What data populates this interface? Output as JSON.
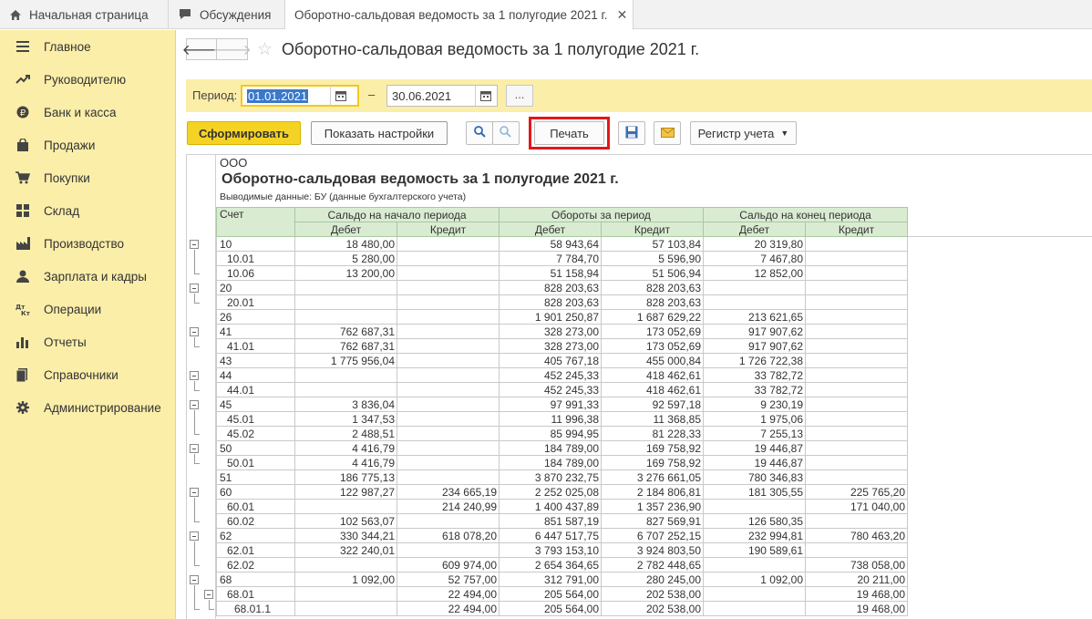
{
  "tabs": [
    {
      "label": "Начальная страница"
    },
    {
      "label": "Обсуждения"
    },
    {
      "label": "Оборотно-сальдовая ведомость за 1 полугодие 2021 г."
    }
  ],
  "sidebar": {
    "items": [
      {
        "label": "Главное",
        "icon": "menu-icon"
      },
      {
        "label": "Руководителю",
        "icon": "trend-icon"
      },
      {
        "label": "Банк и касса",
        "icon": "ruble-icon"
      },
      {
        "label": "Продажи",
        "icon": "bag-icon"
      },
      {
        "label": "Покупки",
        "icon": "cart-icon"
      },
      {
        "label": "Склад",
        "icon": "grid-icon"
      },
      {
        "label": "Производство",
        "icon": "factory-icon"
      },
      {
        "label": "Зарплата и кадры",
        "icon": "person-icon"
      },
      {
        "label": "Операции",
        "icon": "dt-kt-icon"
      },
      {
        "label": "Отчеты",
        "icon": "bar-chart-icon"
      },
      {
        "label": "Справочники",
        "icon": "books-icon"
      },
      {
        "label": "Администрирование",
        "icon": "gear-icon"
      }
    ]
  },
  "header": {
    "title": "Оборотно-сальдовая ведомость за 1 полугодие 2021 г."
  },
  "period": {
    "label": "Период:",
    "from": "01.01.2021",
    "dash": "–",
    "to": "30.06.2021",
    "more": "..."
  },
  "toolbar": {
    "generate": "Сформировать",
    "show_settings": "Показать настройки",
    "print": "Печать",
    "register": "Регистр учета"
  },
  "report": {
    "org": "ООО",
    "title": "Оборотно-сальдовая ведомость за 1 полугодие 2021 г.",
    "subtitle": "Выводимые данные:   БУ (данные бухгалтерского учета)",
    "headers": {
      "account": "Счет",
      "opening": "Сальдо на начало периода",
      "turnover": "Обороты за период",
      "closing": "Сальдо на конец периода",
      "debit": "Дебет",
      "credit": "Кредит"
    },
    "rows": [
      [
        "10",
        "18 480,00",
        "",
        "58 943,64",
        "57 103,84",
        "20 319,80",
        ""
      ],
      [
        "10.01",
        "5 280,00",
        "",
        "7 784,70",
        "5 596,90",
        "7 467,80",
        ""
      ],
      [
        "10.06",
        "13 200,00",
        "",
        "51 158,94",
        "51 506,94",
        "12 852,00",
        ""
      ],
      [
        "20",
        "",
        "",
        "828 203,63",
        "828 203,63",
        "",
        ""
      ],
      [
        "20.01",
        "",
        "",
        "828 203,63",
        "828 203,63",
        "",
        ""
      ],
      [
        "26",
        "",
        "",
        "1 901 250,87",
        "1 687 629,22",
        "213 621,65",
        ""
      ],
      [
        "41",
        "762 687,31",
        "",
        "328 273,00",
        "173 052,69",
        "917 907,62",
        ""
      ],
      [
        "41.01",
        "762 687,31",
        "",
        "328 273,00",
        "173 052,69",
        "917 907,62",
        ""
      ],
      [
        "43",
        "1 775 956,04",
        "",
        "405 767,18",
        "455 000,84",
        "1 726 722,38",
        ""
      ],
      [
        "44",
        "",
        "",
        "452 245,33",
        "418 462,61",
        "33 782,72",
        ""
      ],
      [
        "44.01",
        "",
        "",
        "452 245,33",
        "418 462,61",
        "33 782,72",
        ""
      ],
      [
        "45",
        "3 836,04",
        "",
        "97 991,33",
        "92 597,18",
        "9 230,19",
        ""
      ],
      [
        "45.01",
        "1 347,53",
        "",
        "11 996,38",
        "11 368,85",
        "1 975,06",
        ""
      ],
      [
        "45.02",
        "2 488,51",
        "",
        "85 994,95",
        "81 228,33",
        "7 255,13",
        ""
      ],
      [
        "50",
        "4 416,79",
        "",
        "184 789,00",
        "169 758,92",
        "19 446,87",
        ""
      ],
      [
        "50.01",
        "4 416,79",
        "",
        "184 789,00",
        "169 758,92",
        "19 446,87",
        ""
      ],
      [
        "51",
        "186 775,13",
        "",
        "3 870 232,75",
        "3 276 661,05",
        "780 346,83",
        ""
      ],
      [
        "60",
        "122 987,27",
        "234 665,19",
        "2 252 025,08",
        "2 184 806,81",
        "181 305,55",
        "225 765,20"
      ],
      [
        "60.01",
        "",
        "214 240,99",
        "1 400 437,89",
        "1 357 236,90",
        "",
        "171 040,00"
      ],
      [
        "60.02",
        "102 563,07",
        "",
        "851 587,19",
        "827 569,91",
        "126 580,35",
        ""
      ],
      [
        "62",
        "330 344,21",
        "618 078,20",
        "6 447 517,75",
        "6 707 252,15",
        "232 994,81",
        "780 463,20"
      ],
      [
        "62.01",
        "322 240,01",
        "",
        "3 793 153,10",
        "3 924 803,50",
        "190 589,61",
        ""
      ],
      [
        "62.02",
        "",
        "609 974,00",
        "2 654 364,65",
        "2 782 448,65",
        "",
        "738 058,00"
      ],
      [
        "68",
        "1 092,00",
        "52 757,00",
        "312 791,00",
        "280 245,00",
        "1 092,00",
        "20 211,00"
      ],
      [
        "68.01",
        "",
        "22 494,00",
        "205 564,00",
        "202 538,00",
        "",
        "19 468,00"
      ],
      [
        "68.01.1",
        "",
        "22 494,00",
        "205 564,00",
        "202 538,00",
        "",
        "19 468,00"
      ]
    ]
  }
}
